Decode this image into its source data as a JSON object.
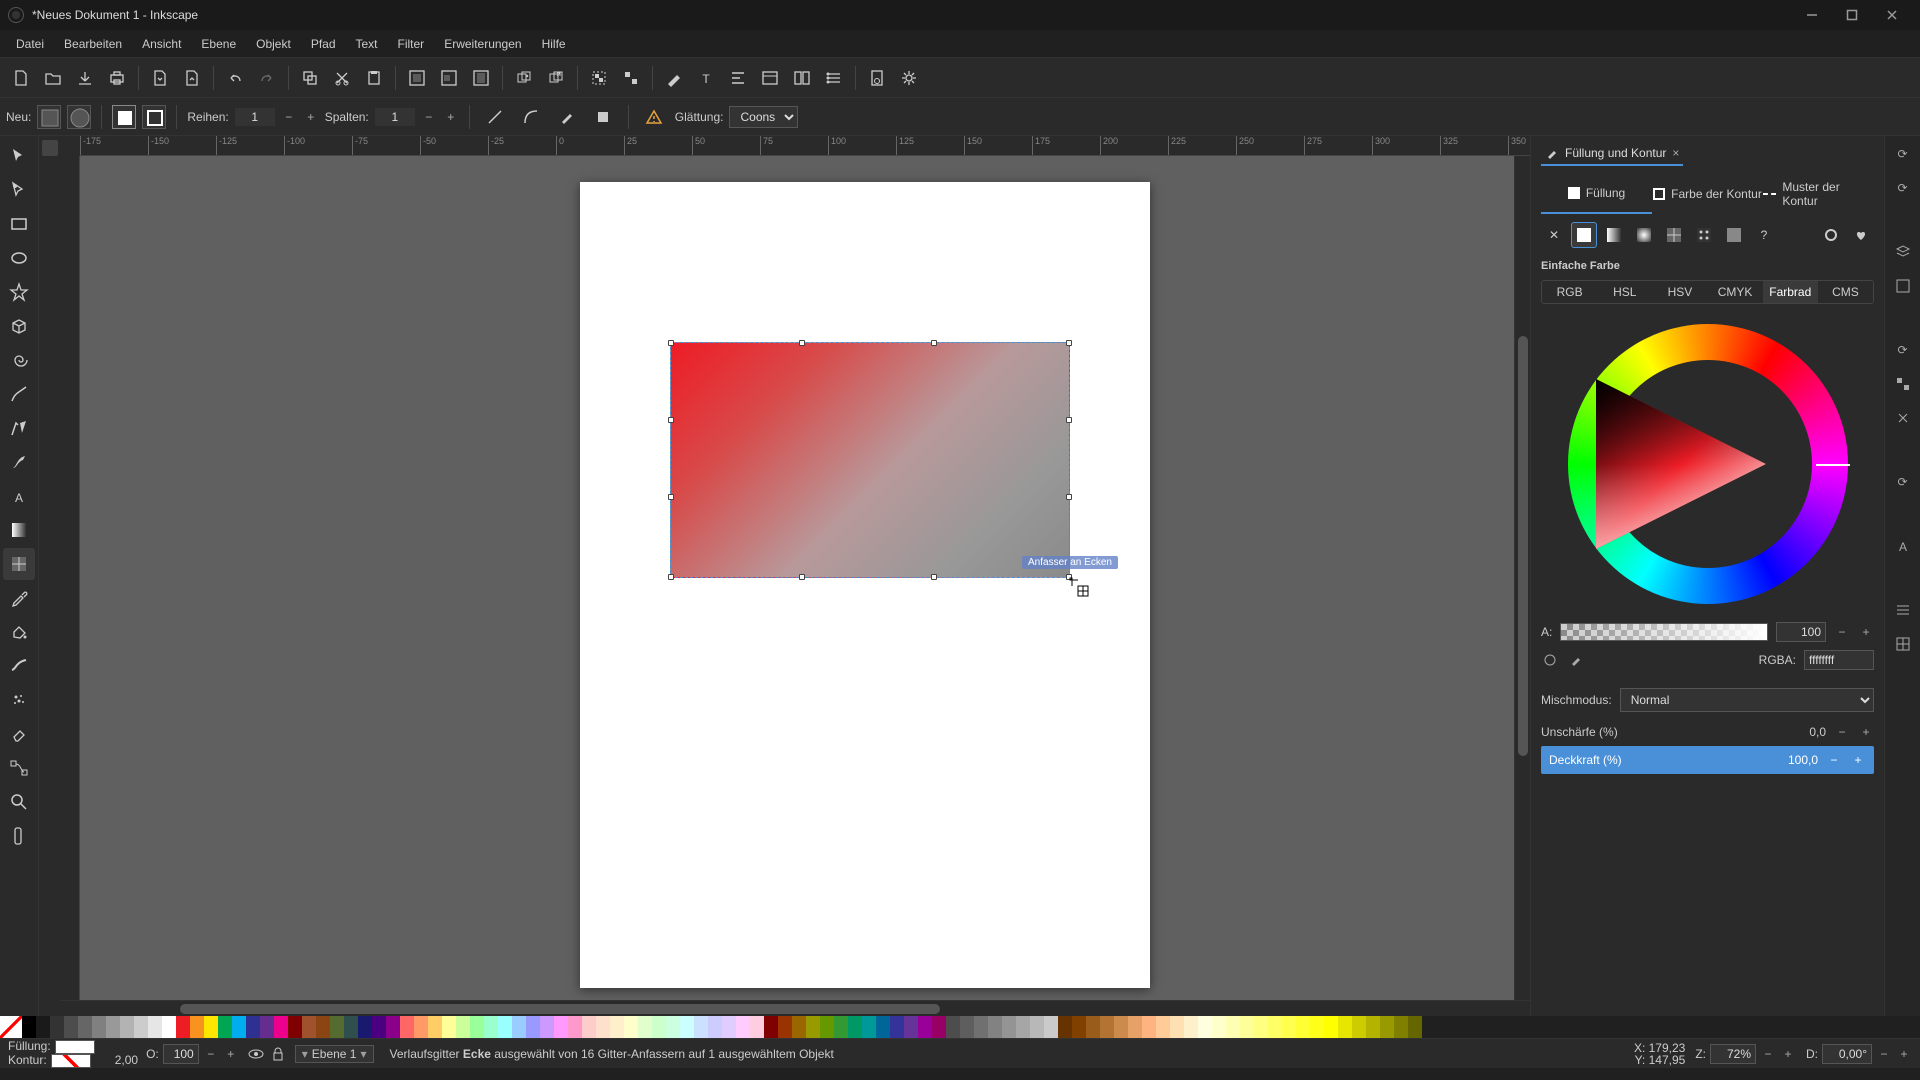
{
  "window": {
    "title": "*Neues Dokument 1 - Inkscape"
  },
  "menu": {
    "items": [
      "Datei",
      "Bearbeiten",
      "Ansicht",
      "Ebene",
      "Objekt",
      "Pfad",
      "Text",
      "Filter",
      "Erweiterungen",
      "Hilfe"
    ]
  },
  "toolbar2": {
    "new_label": "Neu:",
    "rows_label": "Reihen:",
    "rows_value": "1",
    "cols_label": "Spalten:",
    "cols_value": "1",
    "smoothing_label": "Glättung:",
    "smoothing_value": "Coons"
  },
  "ruler_ticks": [
    "-175",
    "-150",
    "-125",
    "-100",
    "-75",
    "-50",
    "-25",
    "0",
    "25",
    "50",
    "75",
    "100",
    "125",
    "150",
    "175",
    "200",
    "225",
    "250",
    "275",
    "300",
    "325",
    "350"
  ],
  "canvas_tooltip": "Anfasser an Ecken",
  "panel": {
    "title": "Füllung und Kontur",
    "tabs": {
      "fill": "Füllung",
      "stroke_paint": "Farbe der Kontur",
      "stroke_style": "Muster der Kontur"
    },
    "flat_label": "Einfache Farbe",
    "color_models": [
      "RGB",
      "HSL",
      "HSV",
      "CMYK",
      "Farbrad",
      "CMS"
    ],
    "alpha_label": "A:",
    "alpha_value": "100",
    "rgba_label": "RGBA:",
    "rgba_value": "ffffffff",
    "blend_label": "Mischmodus:",
    "blend_value": "Normal",
    "blur_label": "Unschärfe (%)",
    "blur_value": "0,0",
    "opacity_label": "Deckkraft (%)",
    "opacity_value": "100,0"
  },
  "status": {
    "fill_label": "Füllung:",
    "stroke_label": "Kontur:",
    "stroke_width": "2,00",
    "opacity_label": "O:",
    "opacity_value": "100",
    "layer": "Ebene 1",
    "msg_pre": "Verlaufsgitter ",
    "msg_bold": "Ecke",
    "msg_post": " ausgewählt von 16 Gitter-Anfassern auf 1 ausgewähltem Objekt",
    "x_label": "X:",
    "x_value": "179,23",
    "y_label": "Y:",
    "y_value": "147,95",
    "z_label": "Z:",
    "z_value": "72%",
    "r_label": "D:",
    "r_value": "0,00°"
  },
  "palette_colors": [
    "#000000",
    "#1a1a1a",
    "#333333",
    "#4d4d4d",
    "#666666",
    "#808080",
    "#999999",
    "#b3b3b3",
    "#cccccc",
    "#e6e6e6",
    "#ffffff",
    "#ee1c25",
    "#f7931e",
    "#ffe600",
    "#00a651",
    "#00aeef",
    "#2e3192",
    "#662d91",
    "#ec008c",
    "#7f0000",
    "#a0522d",
    "#8b4513",
    "#556b2f",
    "#2f4f4f",
    "#191970",
    "#4b0082",
    "#8b008b",
    "#ff6666",
    "#ff9966",
    "#ffcc66",
    "#ffff99",
    "#ccff99",
    "#99ff99",
    "#99ffcc",
    "#99ffff",
    "#99ccff",
    "#9999ff",
    "#cc99ff",
    "#ff99ff",
    "#ff99cc",
    "#ffcccc",
    "#ffe0cc",
    "#fff0cc",
    "#ffffcc",
    "#e0ffcc",
    "#ccffcc",
    "#ccffe0",
    "#ccffff",
    "#cce0ff",
    "#ccccff",
    "#e0ccff",
    "#ffccff",
    "#ffcce0",
    "#800000",
    "#993300",
    "#996600",
    "#999900",
    "#669900",
    "#339933",
    "#009966",
    "#009999",
    "#006699",
    "#333399",
    "#663399",
    "#990099",
    "#990066",
    "#4d4d4d",
    "#5e5e5e",
    "#707070",
    "#828282",
    "#949494",
    "#a6a6a6",
    "#b8b8b8",
    "#cacaca",
    "#663300",
    "#804000",
    "#995c1a",
    "#b37333",
    "#cc8a4d",
    "#e6a166",
    "#ffb380",
    "#ffcc99",
    "#ffe0b3",
    "#fff0cc",
    "#ffffe0",
    "#ffffcc",
    "#ffffb3",
    "#ffff99",
    "#ffff80",
    "#ffff66",
    "#ffff4d",
    "#ffff33",
    "#ffff1a",
    "#ffff00",
    "#e6e600",
    "#cccc00",
    "#b3b300",
    "#999900",
    "#808000",
    "#666600"
  ]
}
